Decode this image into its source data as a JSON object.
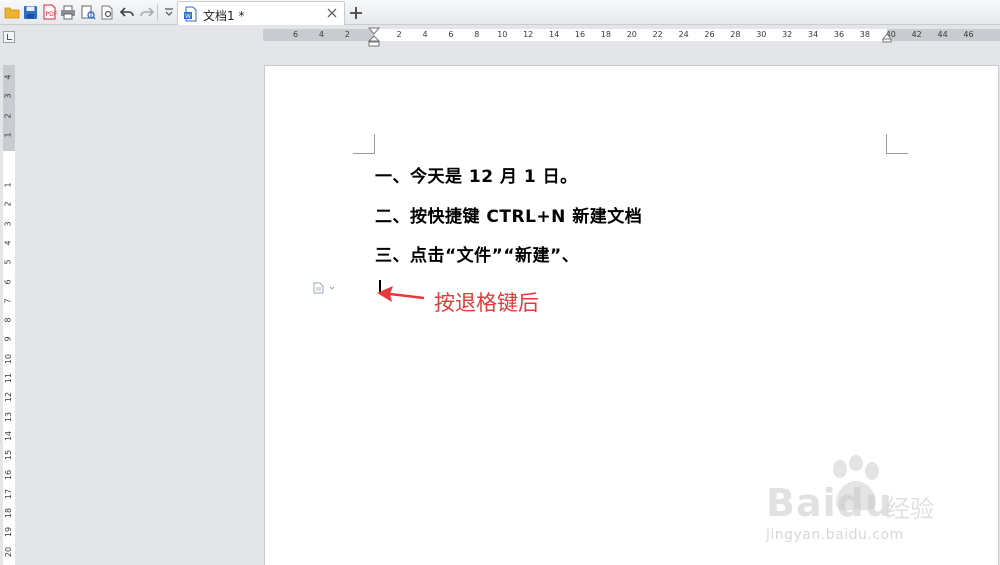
{
  "tab": {
    "title": "文档1 *"
  },
  "quick_access": [
    {
      "name": "open-icon"
    },
    {
      "name": "save-icon"
    },
    {
      "name": "export-pdf-icon"
    },
    {
      "name": "print-icon"
    },
    {
      "name": "print-preview-icon"
    },
    {
      "name": "preview-icon"
    },
    {
      "name": "undo-icon"
    },
    {
      "name": "redo-icon"
    },
    {
      "name": "customize-icon"
    }
  ],
  "hruler_labels": [
    "6",
    "4",
    "2",
    "2",
    "4",
    "6",
    "8",
    "10",
    "12",
    "14",
    "16",
    "18",
    "20",
    "22",
    "24",
    "26",
    "28",
    "30",
    "32",
    "34",
    "36",
    "38",
    "40",
    "42",
    "44",
    "46"
  ],
  "vruler_labels": [
    "4",
    "3",
    "2",
    "1",
    "1",
    "2",
    "3",
    "4",
    "5",
    "6",
    "7",
    "8",
    "9",
    "10",
    "11",
    "12",
    "13",
    "14",
    "15",
    "16",
    "17",
    "18",
    "19",
    "20",
    "21"
  ],
  "document": {
    "paragraphs": [
      "一、今天是 12 月 1 日。",
      "二、按快捷键 CTRL+N 新建文档",
      "三、点击“文件”“新建”、"
    ]
  },
  "annotation": {
    "text": "按退格键后",
    "color": "#e43a3a"
  },
  "watermark": {
    "logo": "Baidu",
    "brand_cn": "经验",
    "url": "jingyan.baidu.com"
  }
}
